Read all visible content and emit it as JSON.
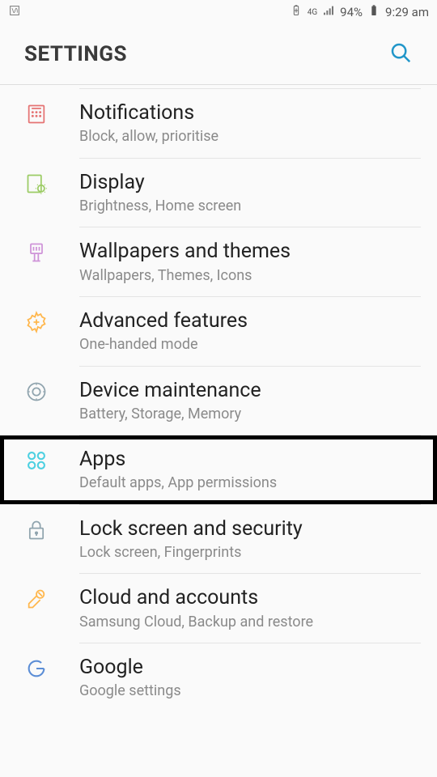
{
  "status": {
    "battery_pct": "94%",
    "time": "9:29 am",
    "network": "4G"
  },
  "header": {
    "title": "SETTINGS"
  },
  "items": [
    {
      "title": "Notifications",
      "subtitle": "Block, allow, prioritise",
      "id": "notifications"
    },
    {
      "title": "Display",
      "subtitle": "Brightness, Home screen",
      "id": "display"
    },
    {
      "title": "Wallpapers and themes",
      "subtitle": "Wallpapers, Themes, Icons",
      "id": "wallpapers-themes"
    },
    {
      "title": "Advanced features",
      "subtitle": "One-handed mode",
      "id": "advanced-features"
    },
    {
      "title": "Device maintenance",
      "subtitle": "Battery, Storage, Memory",
      "id": "device-maintenance"
    },
    {
      "title": "Apps",
      "subtitle": "Default apps, App permissions",
      "id": "apps",
      "highlighted": true
    },
    {
      "title": "Lock screen and security",
      "subtitle": "Lock screen, Fingerprints",
      "id": "lock-screen-security"
    },
    {
      "title": "Cloud and accounts",
      "subtitle": "Samsung Cloud, Backup and restore",
      "id": "cloud-accounts"
    },
    {
      "title": "Google",
      "subtitle": "Google settings",
      "id": "google"
    }
  ]
}
